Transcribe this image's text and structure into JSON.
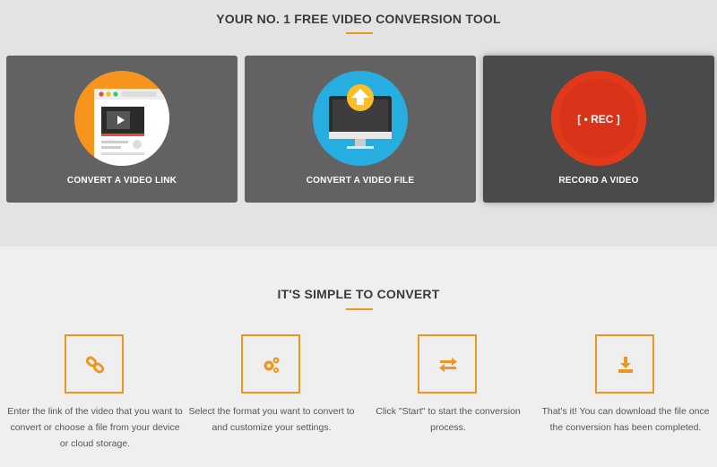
{
  "top": {
    "title": "YOUR NO. 1 FREE VIDEO CONVERSION TOOL",
    "cards": [
      {
        "label": "CONVERT A VIDEO LINK",
        "icon": "video-link-icon",
        "color": "#f7941d"
      },
      {
        "label": "CONVERT A VIDEO FILE",
        "icon": "monitor-upload-icon",
        "color": "#27aee0"
      },
      {
        "label": "RECORD A VIDEO",
        "icon": "record-icon",
        "color": "#e3391b",
        "rec_text": "[ • REC ]"
      }
    ]
  },
  "how": {
    "title": "IT'S SIMPLE TO CONVERT",
    "steps": [
      {
        "icon": "link-icon",
        "text": "Enter the link of the video that you want to convert or choose a file from your device or cloud storage."
      },
      {
        "icon": "gears-icon",
        "text": "Select the format you want to convert to and customize your settings."
      },
      {
        "icon": "swap-arrows-icon",
        "text": "Click \"Start\" to start the conversion process."
      },
      {
        "icon": "download-icon",
        "text": "That's it! You can download the file once the conversion has been completed."
      }
    ]
  },
  "colors": {
    "accent": "#f0961e",
    "card_bg": "#626262",
    "card_active_bg": "#4a4a4a"
  }
}
